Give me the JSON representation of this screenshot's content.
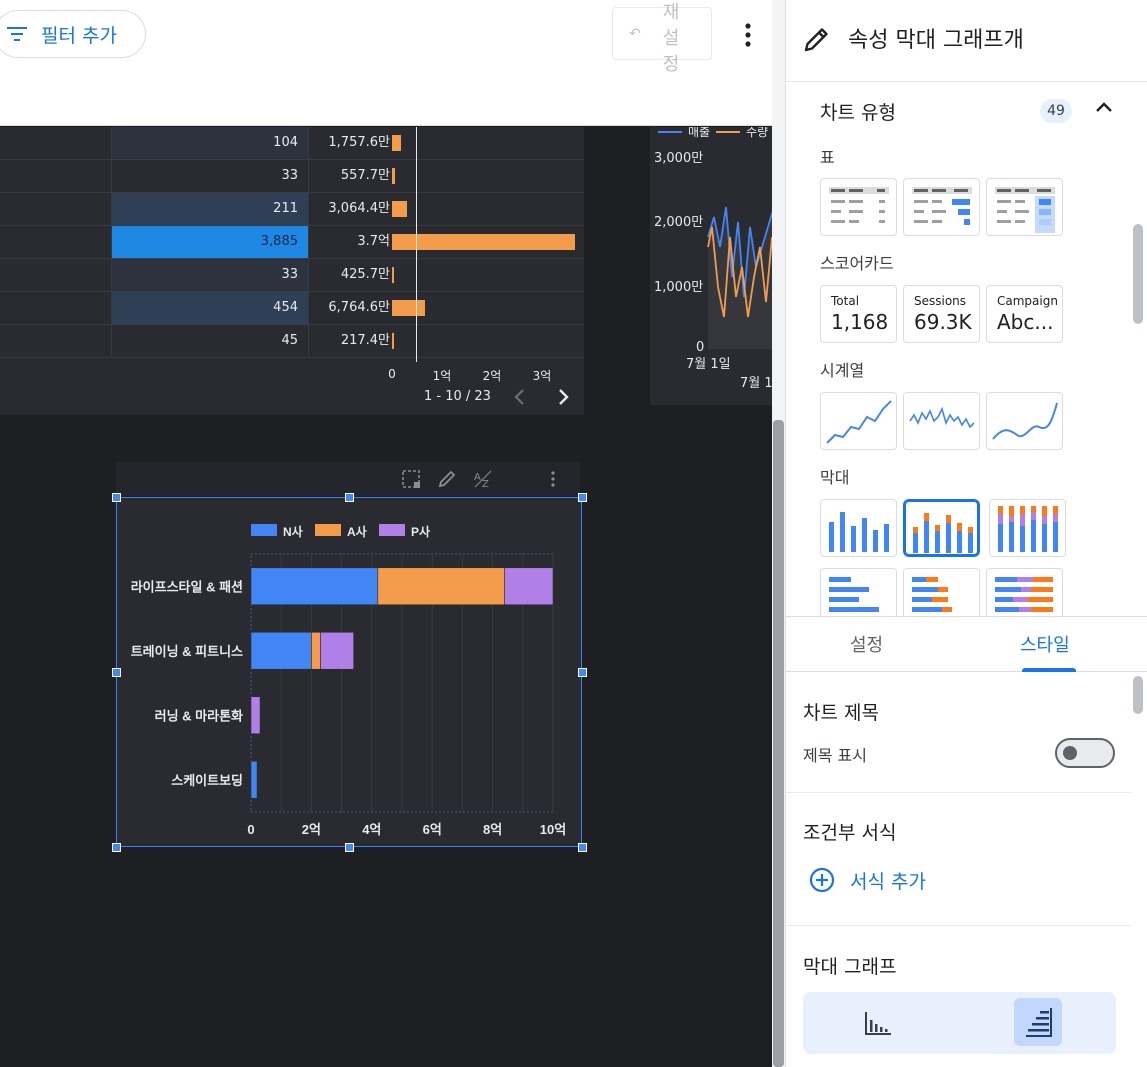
{
  "toolbar": {
    "filter_label": "필터 추가",
    "reset_label": "재설정"
  },
  "table_chart": {
    "rows": [
      {
        "c2": "104",
        "c3": "1,757.6만",
        "bar_value": 1757.6
      },
      {
        "c2": "33",
        "c3": "557.7만",
        "bar_value": 557.7
      },
      {
        "c2": "211",
        "c3": "3,064.4만",
        "bar_value": 3064.4
      },
      {
        "c2": "3,885",
        "c3": "3.7억",
        "bar_value": 37000,
        "highlight": true
      },
      {
        "c2": "33",
        "c3": "425.7만",
        "bar_value": 425.7
      },
      {
        "c2": "454",
        "c3": "6,764.6만",
        "bar_value": 6764.6
      },
      {
        "c2": "45",
        "c3": "217.4만",
        "bar_value": 217.4
      }
    ],
    "axis_ticks": [
      "0",
      "1억",
      "2억",
      "3억"
    ],
    "pager": "1 - 10 / 23"
  },
  "line_chart": {
    "legend": [
      "매출",
      "수량"
    ],
    "y_ticks": [
      "3,000만",
      "2,000만",
      "1,000만",
      "0"
    ],
    "x_ticks": [
      "7월 1일",
      "7월 1"
    ]
  },
  "chart_data": {
    "type": "bar",
    "orientation": "horizontal",
    "stacked": true,
    "categories": [
      "라이프스타일 & 패션",
      "트레이닝 & 피트니스",
      "러닝 & 마라톤화",
      "스케이트보딩"
    ],
    "series": [
      {
        "name": "N사",
        "color": "#4285f4",
        "values": [
          4.2,
          2.0,
          0.0,
          0.2
        ]
      },
      {
        "name": "A사",
        "color": "#f29c4c",
        "values": [
          4.2,
          0.3,
          0.0,
          0.0
        ]
      },
      {
        "name": "P사",
        "color": "#b17fe8",
        "values": [
          1.6,
          1.1,
          0.3,
          0.0
        ]
      }
    ],
    "x_ticks": [
      "0",
      "2억",
      "4억",
      "6억",
      "8억",
      "10억"
    ],
    "xlim": [
      0,
      10
    ],
    "legend_position": "top",
    "grid": true
  },
  "panel": {
    "title": "속성 막대 그래프개",
    "chart_type": {
      "title": "차트 유형",
      "badge": "49",
      "categories": {
        "table": "표",
        "scorecard": "스코어카드",
        "timeseries": "시계열",
        "bar": "막대"
      },
      "scorecards": [
        {
          "label": "Total",
          "value": "1,168"
        },
        {
          "label": "Sessions",
          "value": "69.3K"
        },
        {
          "label": "Campaign",
          "value": "Abc..."
        }
      ]
    },
    "tabs": [
      "설정",
      "스타일"
    ],
    "style": {
      "chart_title_section": "차트 제목",
      "show_title_label": "제목 표시",
      "conditional_section": "조건부 서식",
      "add_format_label": "서식 추가",
      "bar_section": "막대 그래프"
    }
  },
  "colors": {
    "accent": "#1a73e8",
    "series_n": "#4285f4",
    "series_a": "#f29c4c",
    "series_p": "#b17fe8"
  }
}
